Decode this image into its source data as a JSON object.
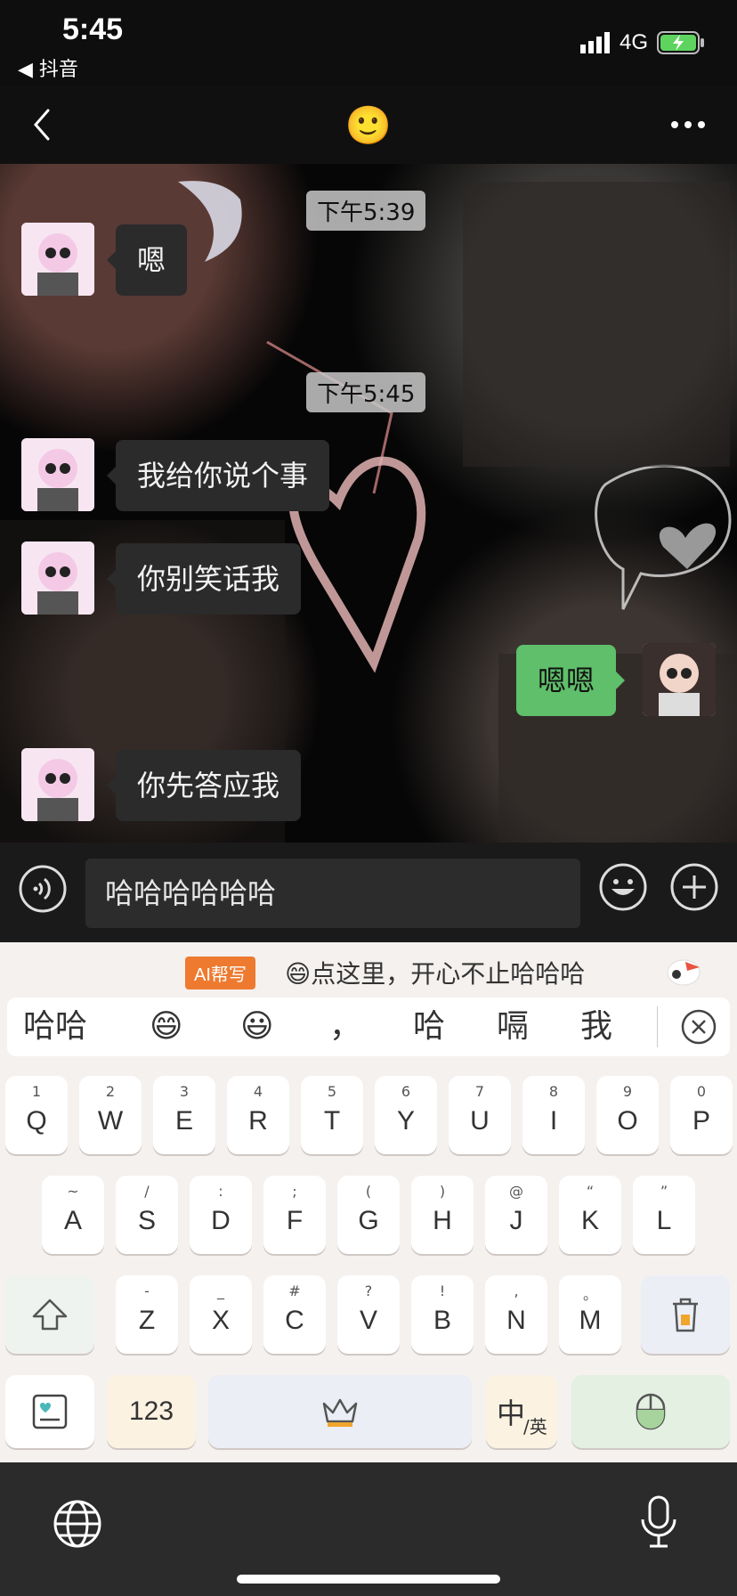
{
  "status_bar": {
    "time": "5:45",
    "back_app": "◀ 抖音",
    "network": "4G"
  },
  "header": {
    "title_emoji": "🙂"
  },
  "chat": {
    "timestamps": [
      "下午5:39",
      "下午5:45"
    ],
    "messages": [
      {
        "side": "left",
        "text": "嗯"
      },
      {
        "side": "left",
        "text": "我给你说个事"
      },
      {
        "side": "left",
        "text": "你别笑话我"
      },
      {
        "side": "right",
        "text": "嗯嗯"
      },
      {
        "side": "left",
        "text": "你先答应我"
      }
    ]
  },
  "input": {
    "value": "哈哈哈哈哈哈"
  },
  "keyboard": {
    "ai_badge": "AI帮写",
    "ai_suggestion": "😄点这里，开心不止哈哈哈",
    "candidates": [
      "哈哈",
      "😄",
      "😃",
      "，",
      "哈",
      "嗝",
      "我"
    ],
    "row1": [
      {
        "sub": "1",
        "key": "Q"
      },
      {
        "sub": "2",
        "key": "W"
      },
      {
        "sub": "3",
        "key": "E"
      },
      {
        "sub": "4",
        "key": "R"
      },
      {
        "sub": "5",
        "key": "T"
      },
      {
        "sub": "6",
        "key": "Y"
      },
      {
        "sub": "7",
        "key": "U"
      },
      {
        "sub": "8",
        "key": "I"
      },
      {
        "sub": "9",
        "key": "O"
      },
      {
        "sub": "0",
        "key": "P"
      }
    ],
    "row2": [
      {
        "sub": "~",
        "key": "A"
      },
      {
        "sub": "/",
        "key": "S"
      },
      {
        "sub": ":",
        "key": "D"
      },
      {
        "sub": ";",
        "key": "F"
      },
      {
        "sub": "(",
        "key": "G"
      },
      {
        "sub": ")",
        "key": "H"
      },
      {
        "sub": "@",
        "key": "J"
      },
      {
        "sub": "“",
        "key": "K"
      },
      {
        "sub": "”",
        "key": "L"
      }
    ],
    "row3": [
      {
        "sub": "-",
        "key": "Z"
      },
      {
        "sub": "_",
        "key": "X"
      },
      {
        "sub": "#",
        "key": "C"
      },
      {
        "sub": "?",
        "key": "V"
      },
      {
        "sub": "!",
        "key": "B"
      },
      {
        "sub": ",",
        "key": "N"
      },
      {
        "sub": "。",
        "key": "M"
      }
    ],
    "num_key": "123",
    "lang_key_main": "中",
    "lang_key_sub": "/英"
  },
  "colors": {
    "bubble_right": "#5fbf6a",
    "bubble_left": "#2b2b2b",
    "ai_badge": "#ee7a30"
  }
}
